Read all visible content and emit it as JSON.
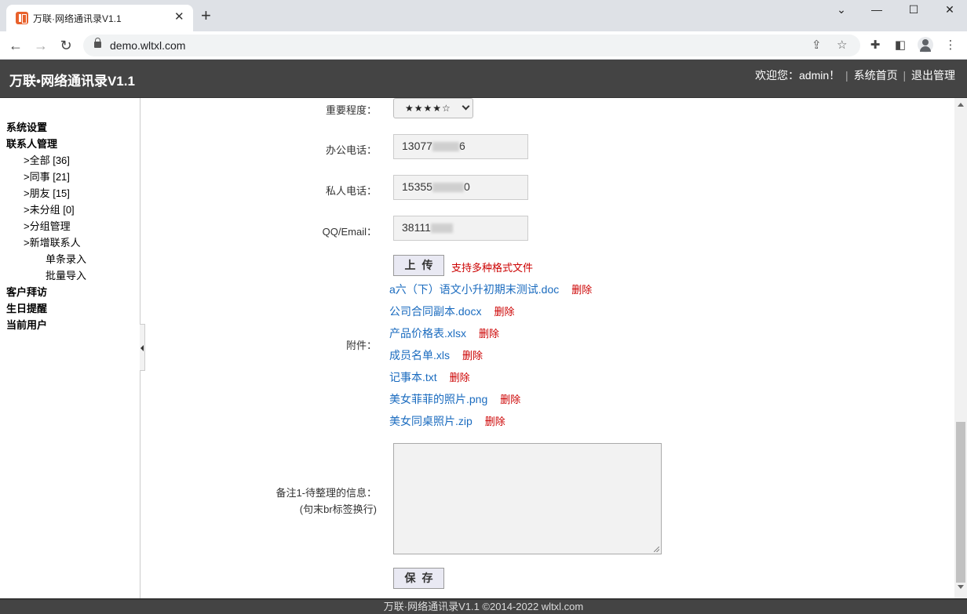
{
  "browser": {
    "tab_title": "万联·网络通讯录V1.1",
    "tab_close": "✕",
    "new_tab": "+",
    "url": "demo.wltxl.com",
    "win_min": "—",
    "win_max": "☐",
    "win_close": "✕",
    "win_chevron": "⌄"
  },
  "header": {
    "title": "万联•网络通讯录V1.1",
    "welcome": "欢迎您：admin！",
    "sep": "|",
    "home_link": "系统首页",
    "logout_link": "退出管理"
  },
  "sidebar": {
    "system_settings": "系统设置",
    "contacts_mgmt": "联系人管理",
    "all": ">全部 [36]",
    "colleagues": ">同事 [21]",
    "friends": ">朋友 [15]",
    "ungrouped": ">未分组 [0]",
    "group_mgmt": ">分组管理",
    "add_contact": ">新增联系人",
    "single_entry": "单条录入",
    "batch_import": "批量导入",
    "customer_visits": "客户拜访",
    "birthday_reminder": "生日提醒",
    "current_user": "当前用户"
  },
  "form": {
    "importance_label": "重要程度：",
    "importance_value": "★★★★☆",
    "office_phone_label": "办公电话：",
    "office_phone_prefix": "13077",
    "office_phone_suffix": "6",
    "private_phone_label": "私人电话：",
    "private_phone_prefix": "15355",
    "private_phone_suffix": "0",
    "qq_email_label": "QQ/Email：",
    "qq_email_prefix": "38111",
    "upload_button": "上传",
    "upload_hint": "支持多种格式文件",
    "attachments_label": "附件：",
    "attachments": [
      {
        "name": "a六（下）语文小升初期末测试.doc",
        "delete": "删除"
      },
      {
        "name": "公司合同副本.docx",
        "delete": "删除"
      },
      {
        "name": "产品价格表.xlsx",
        "delete": "删除"
      },
      {
        "name": "成员名单.xls",
        "delete": "删除"
      },
      {
        "name": "记事本.txt",
        "delete": "删除"
      },
      {
        "name": "美女菲菲的照片.png",
        "delete": "删除"
      },
      {
        "name": "美女同桌照片.zip",
        "delete": "删除"
      }
    ],
    "notes_label_line1": "备注1-待整理的信息：",
    "notes_label_line2": "(句末br标签换行)",
    "notes_value": "",
    "save_button": "保存"
  },
  "footer": {
    "text": "万联·网络通讯录V1.1 ©2014-2022 wltxl.com"
  }
}
